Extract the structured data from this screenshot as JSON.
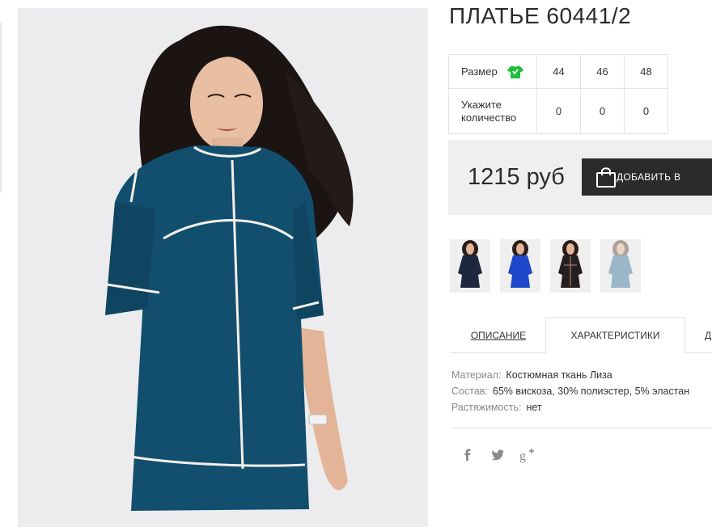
{
  "product": {
    "title": "ПЛАТЬЕ 60441/2"
  },
  "sizes": {
    "header_label": "Размер",
    "size_icon": "tshirt-icon",
    "quantity_label_line1": "Укажите",
    "quantity_label_line2": "количество",
    "columns": [
      {
        "size": "44",
        "quantity": "0"
      },
      {
        "size": "46",
        "quantity": "0"
      },
      {
        "size": "48",
        "quantity": "0"
      }
    ]
  },
  "purchase": {
    "price": "1215 руб",
    "add_to_cart_label": "ДОБАВИТЬ В",
    "cart_icon": "shopping-bag-icon"
  },
  "thumbnails": [
    {
      "name": "dark-navy-dress"
    },
    {
      "name": "royal-blue-dress"
    },
    {
      "name": "black-dress"
    },
    {
      "name": "light-blue-dress"
    }
  ],
  "tabs": [
    {
      "label": "ОПИСАНИЕ",
      "active": false
    },
    {
      "label": "ХАРАКТЕРИСТИКИ",
      "active": true
    },
    {
      "label": "Д",
      "active": false
    }
  ],
  "characteristics": [
    {
      "key": "Материал:",
      "value": "Костюмная ткань Лиза"
    },
    {
      "key": "Состав:",
      "value": "65% вискоза, 30% полиэстер, 5% эластан"
    },
    {
      "key": "Растяжимость:",
      "value": "нет"
    }
  ],
  "social": [
    {
      "icon": "facebook-icon"
    },
    {
      "icon": "twitter-icon"
    },
    {
      "icon": "google-plus-icon"
    }
  ],
  "colors": {
    "dress": "#124e6e",
    "background": "#ececef",
    "button": "#2b2b2b",
    "size_icon": "#1fbf3a"
  }
}
